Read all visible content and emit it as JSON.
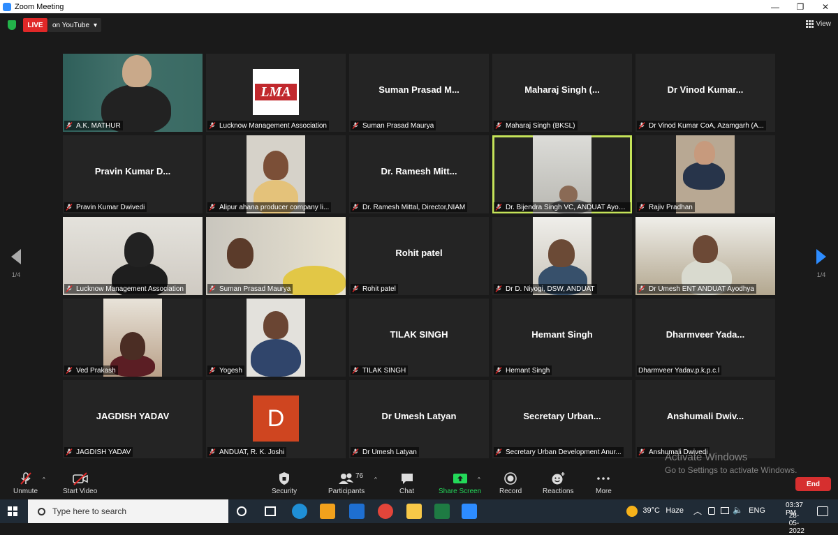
{
  "window": {
    "title": "Zoom Meeting",
    "controls": [
      "—",
      "❐",
      "✕"
    ]
  },
  "topbar": {
    "live_label": "LIVE",
    "live_target": "on YouTube",
    "live_caret": "▾",
    "view_label": "View"
  },
  "tiles": [
    {
      "name": "A.K. MATHUR",
      "type": "video",
      "center": ""
    },
    {
      "name": "Lucknow Management Association",
      "type": "logo",
      "center": ""
    },
    {
      "name": "Suman Prasad Maurya",
      "type": "text",
      "center": "Suman Prasad M..."
    },
    {
      "name": "Maharaj Singh (BKSL)",
      "type": "text",
      "center": "Maharaj Singh (..."
    },
    {
      "name": "Dr Vinod Kumar CoA, Azamgarh (A...",
      "type": "text",
      "center": "Dr Vinod Kumar..."
    },
    {
      "name": "Pravin Kumar Dwivedi",
      "type": "text",
      "center": "Pravin Kumar D..."
    },
    {
      "name": "Alipur ahana producer company li...",
      "type": "video",
      "center": ""
    },
    {
      "name": "Dr. Ramesh Mittal, Director,NIAM",
      "type": "text",
      "center": "Dr. Ramesh Mitt..."
    },
    {
      "name": "Dr. Bijendra Singh VC, ANDUAT Ayodh...",
      "type": "video",
      "center": ""
    },
    {
      "name": "Rajiv Pradhan",
      "type": "video",
      "center": ""
    },
    {
      "name": "Lucknow Management Association",
      "type": "video",
      "center": ""
    },
    {
      "name": "Suman Prasad Maurya",
      "type": "video",
      "center": ""
    },
    {
      "name": "Rohit patel",
      "type": "text",
      "center": "Rohit patel"
    },
    {
      "name": "Dr D. Niyogi, DSW, ANDUAT",
      "type": "video",
      "center": ""
    },
    {
      "name": "Dr Umesh ENT ANDUAT Ayodhya",
      "type": "video",
      "center": ""
    },
    {
      "name": "Ved Prakash",
      "type": "video",
      "center": ""
    },
    {
      "name": "Yogesh",
      "type": "video",
      "center": ""
    },
    {
      "name": "TILAK SINGH",
      "type": "text",
      "center": "TILAK SINGH"
    },
    {
      "name": "Hemant Singh",
      "type": "text",
      "center": "Hemant Singh"
    },
    {
      "name": "Dharmveer Yadav.p.k.p.c.l",
      "type": "text",
      "center": "Dharmveer Yada..."
    },
    {
      "name": "JAGDISH YADAV",
      "type": "text",
      "center": "JAGDISH YADAV"
    },
    {
      "name": "ANDUAT, R. K. Joshi",
      "type": "avatar",
      "center": ""
    },
    {
      "name": "Dr Umesh Latyan",
      "type": "text",
      "center": "Dr Umesh Latyan"
    },
    {
      "name": "Secretary Urban Development Anur...",
      "type": "text",
      "center": "Secretary Urban..."
    },
    {
      "name": "Anshumali Dwivedi",
      "type": "text",
      "center": "Anshumali Dwiv..."
    }
  ],
  "logo": {
    "lma_text": "LMA",
    "avatar_letter": "D"
  },
  "pager": {
    "left_label": "1/4",
    "right_label": "1/4"
  },
  "toolbar": {
    "unmute": "Unmute",
    "start_video": "Start Video",
    "security": "Security",
    "participants": "Participants",
    "participants_count": "76",
    "chat": "Chat",
    "share_screen": "Share Screen",
    "record": "Record",
    "reactions": "Reactions",
    "more": "More",
    "end": "End",
    "caret": "^"
  },
  "watermark": {
    "line1": "Activate Windows",
    "line2": "Go to Settings to activate Windows."
  },
  "taskbar": {
    "search_placeholder": "Type here to search",
    "weather": "39°C",
    "weather_desc": "Haze",
    "lang": "ENG",
    "time": "03:37 PM",
    "date": "28-05-2022"
  },
  "colors": {
    "live_red": "#e02828",
    "active_speaker": "#c5e359",
    "share_green": "#23d959",
    "end_red": "#d62f2f",
    "taskbar": "#202b36"
  }
}
